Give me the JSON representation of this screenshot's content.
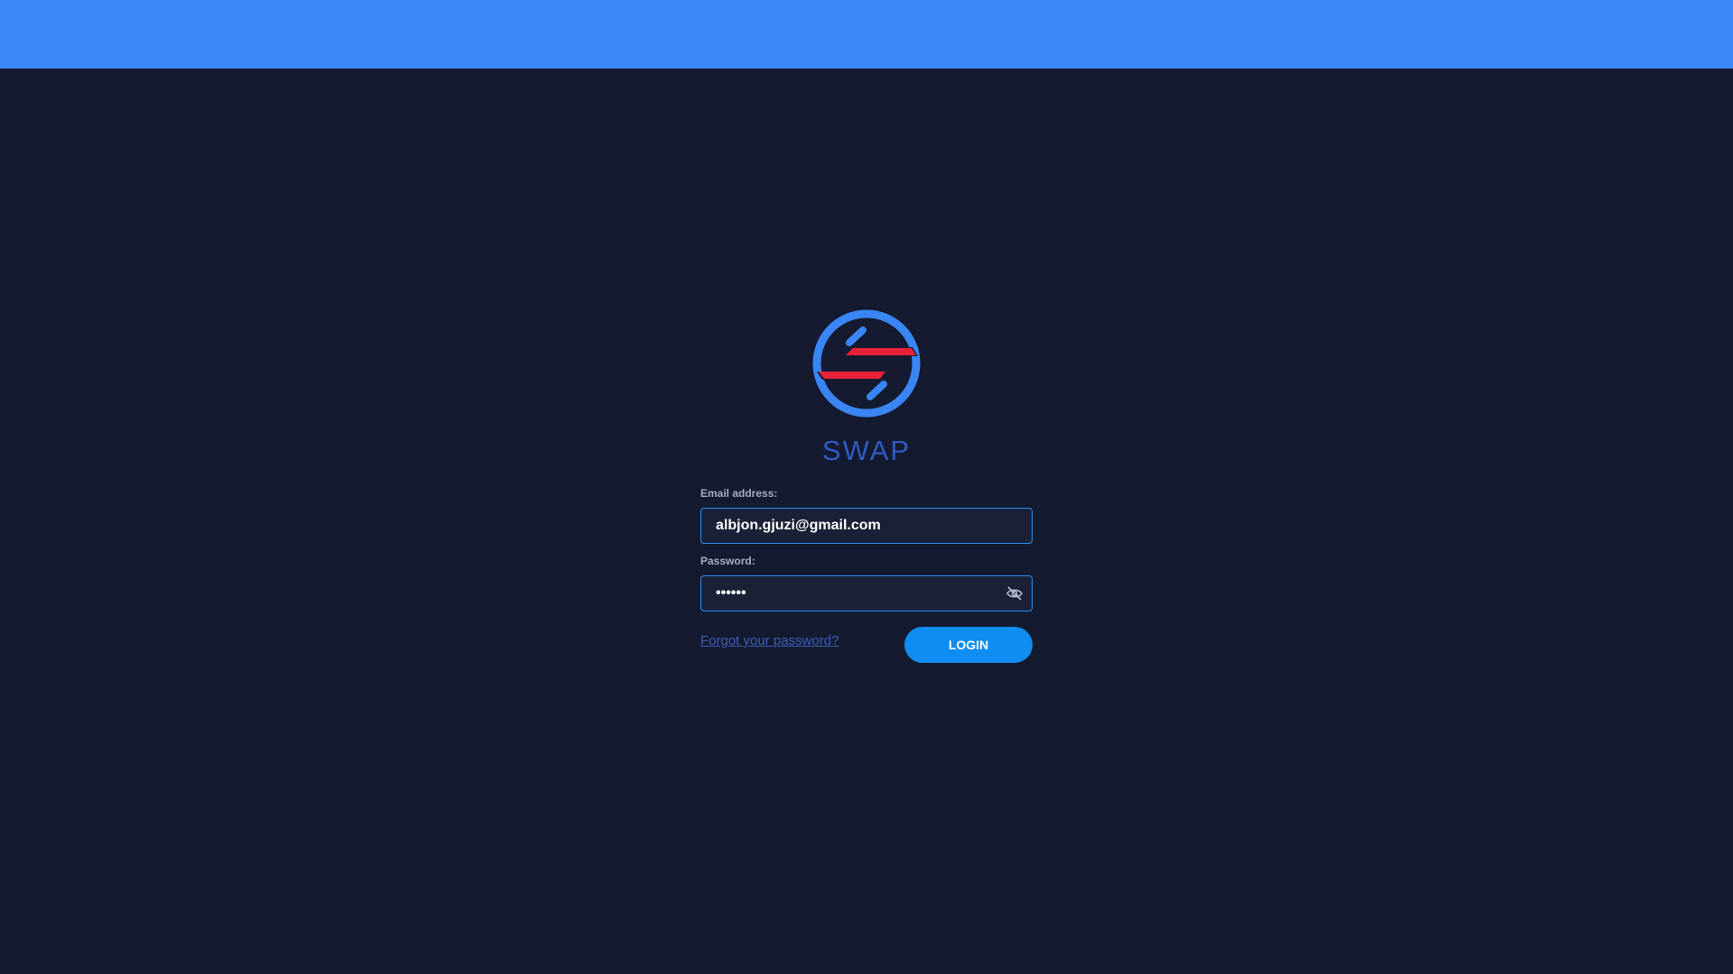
{
  "header": {
    "bar_color": "#3a88f8"
  },
  "brand": {
    "name": "SWAP",
    "logo_icon": "swap-logo-icon",
    "colors": {
      "ring": "#3b86f5",
      "stripe": "#e8223a",
      "text": "#2f5bc4"
    }
  },
  "form": {
    "email_label": "Email address:",
    "email_value": "albjon.gjuzi@gmail.com",
    "password_label": "Password:",
    "password_value": "••••••",
    "password_toggle_icon": "eye-off-icon",
    "forgot_link": "Forgot your password?",
    "login_button": "LOGIN"
  }
}
